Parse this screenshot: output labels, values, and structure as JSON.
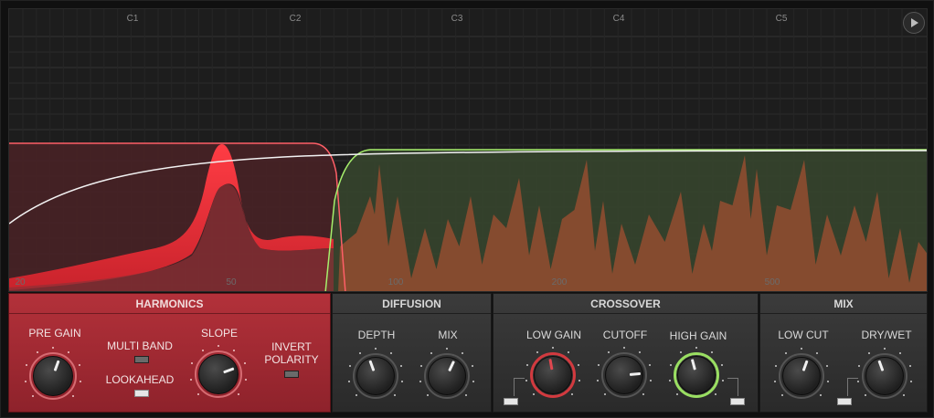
{
  "display": {
    "notes": [
      "C1",
      "C2",
      "C3",
      "C4",
      "C5"
    ],
    "freq_labels": [
      "20",
      "50",
      "100",
      "200",
      "500"
    ],
    "play_icon": "play-icon"
  },
  "harmonics": {
    "title": "HARMONICS",
    "pre_gain": "PRE GAIN",
    "multi_band": "MULTI BAND",
    "lookahead": "LOOKAHEAD",
    "slope": "SLOPE",
    "invert": "INVERT",
    "polarity": "POLARITY",
    "multi_band_on": false,
    "lookahead_on": true,
    "invert_polarity_on": false
  },
  "diffusion": {
    "title": "DIFFUSION",
    "depth": "DEPTH",
    "mix": "MIX"
  },
  "crossover": {
    "title": "CROSSOVER",
    "low_gain": "LOW GAIN",
    "cutoff": "CUTOFF",
    "high_gain": "HIGH GAIN"
  },
  "mix": {
    "title": "MIX",
    "low_cut": "LOW CUT",
    "dry_wet": "DRY/WET"
  },
  "colors": {
    "harmonics_panel": "#a52a33",
    "low_band": "#d23a3f",
    "high_band": "#9adf62",
    "spectrum": "#8a4a2c"
  }
}
